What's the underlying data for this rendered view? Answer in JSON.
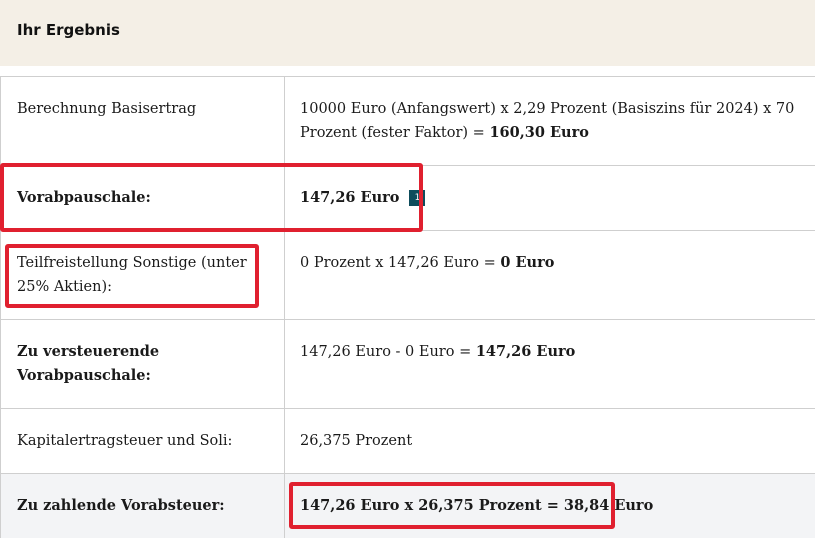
{
  "header": {
    "title": "Ihr Ergebnis"
  },
  "rows": [
    {
      "label": "Berechnung Basisertrag",
      "value_text": "10000 Euro (Anfangswert) x 2,29 Prozent (Basiszins für 2024) x 70 Prozent (fester Faktor) = ",
      "value_bold": "160,30 Euro"
    },
    {
      "label": "Vorabpauschale:",
      "value_bold": "147,26 Euro",
      "badge": "1"
    },
    {
      "label": "Teilfreistellung Sonstige (unter 25% Aktien):",
      "value_text": "0 Prozent x 147,26 Euro = ",
      "value_bold": "0 Euro"
    },
    {
      "label": "Zu versteuerende Vorabpauschale:",
      "value_text": "147,26 Euro - 0 Euro = ",
      "value_bold": "147,26 Euro"
    },
    {
      "label": "Kapitalertragsteuer und Soli:",
      "value_text": "26,375 Prozent"
    },
    {
      "label": "Zu zahlende Vorabsteuer:",
      "value_bold": "147,26 Euro x 26,375 Prozent = 38,84 Euro"
    }
  ],
  "colors": {
    "highlight": "#e0202f",
    "header_bg": "#f4efe6",
    "badge_bg": "#0e4d5c"
  }
}
